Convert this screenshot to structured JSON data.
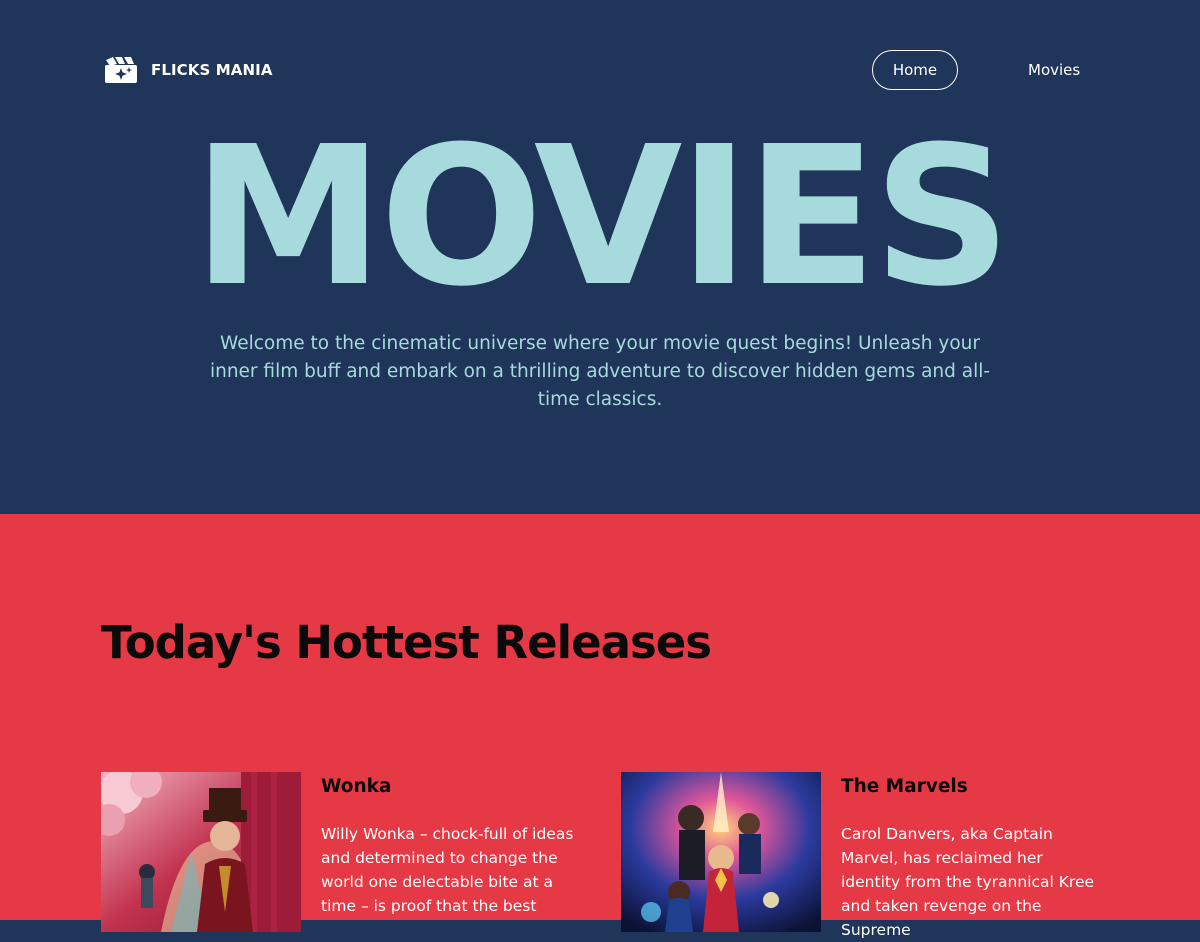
{
  "brand": {
    "name": "FLICKS MANIA",
    "logo_icon": "clapperboard-sparkle-icon"
  },
  "nav": {
    "items": [
      {
        "label": "Home",
        "active": true
      },
      {
        "label": "Movies",
        "active": false
      }
    ]
  },
  "hero": {
    "title": "MOVIES",
    "description": "Welcome to the cinematic universe where your movie quest begins! Unleash your inner film buff and embark on a thrilling adventure to discover hidden gems and all-time classics."
  },
  "releases": {
    "heading": "Today's Hottest Releases",
    "movies": [
      {
        "title": "Wonka",
        "description": "Willy Wonka – chock-full of ideas and determined to change the world one delectable bite at a time – is proof that the best",
        "poster": "wonka-poster"
      },
      {
        "title": "The Marvels",
        "description": "Carol Danvers, aka Captain Marvel, has reclaimed her identity from the tyrannical Kree and taken revenge on the Supreme",
        "poster": "the-marvels-poster"
      }
    ]
  },
  "colors": {
    "hero_bg": "#1f3559",
    "hero_text": "#a7dadc",
    "releases_bg": "#e63946",
    "heading_text": "#0a0a0a",
    "body_text": "#ffffff"
  }
}
